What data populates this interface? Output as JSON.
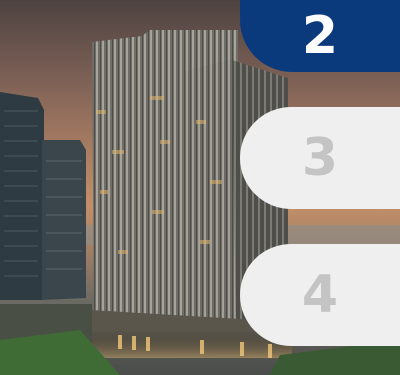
{
  "steps": [
    {
      "label": "2",
      "state": "active"
    },
    {
      "label": "3",
      "state": "inactive"
    },
    {
      "label": "4",
      "state": "inactive"
    }
  ],
  "colors": {
    "active_bg": "#0a3a7c",
    "active_text": "#ffffff",
    "inactive_bg": "#efefef",
    "inactive_text": "#c4c4c4"
  },
  "image": {
    "subject": "skyscraper-photo"
  }
}
